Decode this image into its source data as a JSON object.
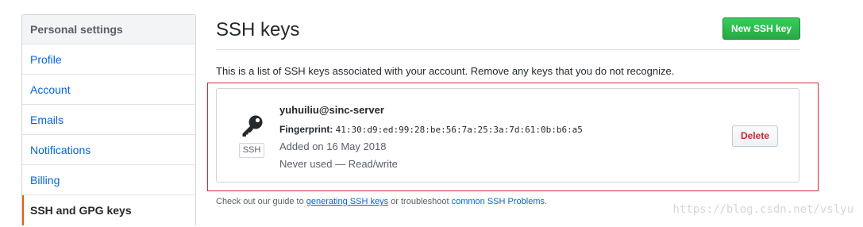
{
  "sidebar": {
    "header": "Personal settings",
    "items": [
      {
        "label": "Profile"
      },
      {
        "label": "Account"
      },
      {
        "label": "Emails"
      },
      {
        "label": "Notifications"
      },
      {
        "label": "Billing"
      },
      {
        "label": "SSH and GPG keys",
        "selected": true
      }
    ]
  },
  "main": {
    "title": "SSH keys",
    "new_key_button": "New SSH key",
    "intro": "This is a list of SSH keys associated with your account. Remove any keys that you do not recognize."
  },
  "key": {
    "icon": "key-icon",
    "badge": "SSH",
    "title": "yuhuiliu@sinc-server",
    "fingerprint_label": "Fingerprint:",
    "fingerprint": "41:30:d9:ed:99:28:be:56:7a:25:3a:7d:61:0b:b6:a5",
    "added": "Added on 16 May 2018",
    "usage": "Never used — Read/write",
    "delete_button": "Delete"
  },
  "footer": {
    "prefix": "Check out our guide to",
    "link1": "generating SSH keys",
    "middle": "or troubleshoot",
    "link2": "common SSH Problems",
    "suffix": "."
  },
  "watermark": "https://blog.csdn.net/vslyu",
  "colors": {
    "accent_link": "#0366d6",
    "primary_button": "#28a745",
    "danger": "#cb2431",
    "selected_marker": "#e36209",
    "highlight_frame": "#e0282f"
  }
}
